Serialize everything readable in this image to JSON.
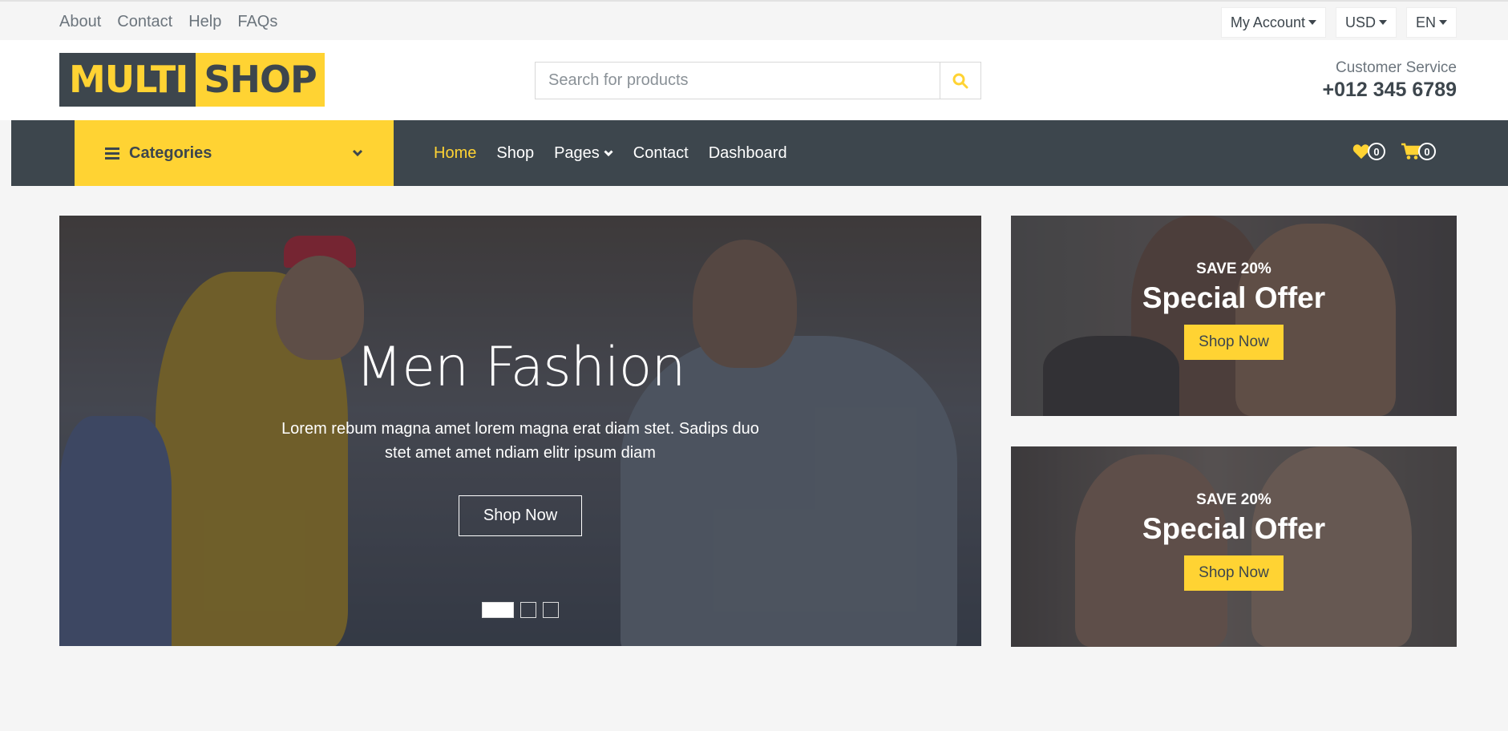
{
  "topbar": {
    "links": [
      "About",
      "Contact",
      "Help",
      "FAQs"
    ],
    "account": "My Account",
    "currency": "USD",
    "language": "EN"
  },
  "header": {
    "logo_part1": "MULTI",
    "logo_part2": "SHOP",
    "search_placeholder": "Search for products",
    "service_label": "Customer Service",
    "service_phone": "+012 345 6789"
  },
  "navbar": {
    "categories_label": "Categories",
    "links": [
      "Home",
      "Shop",
      "Pages",
      "Contact",
      "Dashboard"
    ],
    "active_link": "Home",
    "wishlist_count": "0",
    "cart_count": "0"
  },
  "carousel": {
    "title": "Men Fashion",
    "text": "Lorem rebum magna amet lorem magna erat diam stet. Sadips duo stet amet amet ndiam elitr ipsum diam",
    "button": "Shop Now",
    "slides": 3,
    "active_slide": 1
  },
  "offers": [
    {
      "save": "SAVE 20%",
      "title": "Special Offer",
      "button": "Shop Now"
    },
    {
      "save": "SAVE 20%",
      "title": "Special Offer",
      "button": "Shop Now"
    }
  ],
  "colors": {
    "primary": "#ffd333",
    "dark": "#3d464d",
    "background": "#f5f5f5"
  }
}
